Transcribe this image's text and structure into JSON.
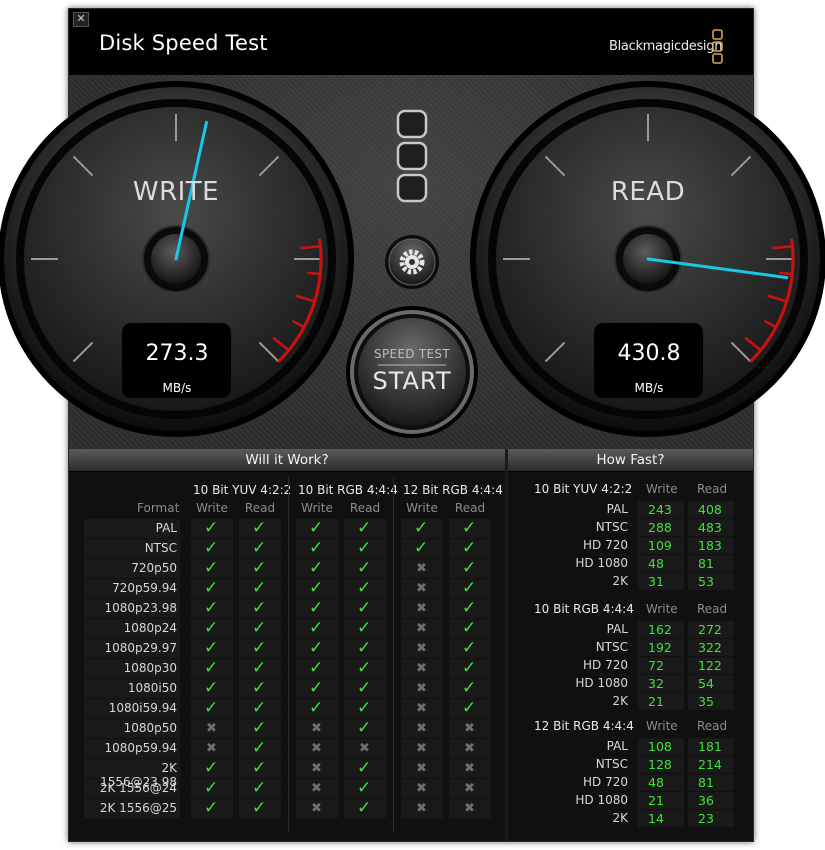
{
  "window": {
    "title": "Disk Speed Test",
    "brand": "Blackmagicdesign",
    "close_label": "✕"
  },
  "gauges": {
    "write": {
      "label": "WRITE",
      "value": "273.3",
      "unit": "MB/s"
    },
    "read": {
      "label": "READ",
      "value": "430.8",
      "unit": "MB/s"
    }
  },
  "start_button": {
    "line1": "SPEED TEST",
    "line2": "START"
  },
  "icons": {
    "settings": "gear-icon",
    "logo": "blackmagic-logo-icon"
  },
  "colors": {
    "accent_needle": "#19c8e8",
    "ok_check": "#3fe23a",
    "redline": "#d01010"
  },
  "will_it_work": {
    "title": "Will it Work?",
    "format_header": "Format",
    "groups": [
      "10 Bit YUV 4:2:2",
      "10 Bit RGB 4:4:4",
      "12 Bit RGB 4:4:4"
    ],
    "sub": [
      "Write",
      "Read"
    ],
    "rows": [
      {
        "format": "PAL",
        "s": [
          1,
          1,
          1,
          1,
          1,
          1
        ]
      },
      {
        "format": "NTSC",
        "s": [
          1,
          1,
          1,
          1,
          1,
          1
        ]
      },
      {
        "format": "720p50",
        "s": [
          1,
          1,
          1,
          1,
          0,
          1
        ]
      },
      {
        "format": "720p59.94",
        "s": [
          1,
          1,
          1,
          1,
          0,
          1
        ]
      },
      {
        "format": "1080p23.98",
        "s": [
          1,
          1,
          1,
          1,
          0,
          1
        ]
      },
      {
        "format": "1080p24",
        "s": [
          1,
          1,
          1,
          1,
          0,
          1
        ]
      },
      {
        "format": "1080p29.97",
        "s": [
          1,
          1,
          1,
          1,
          0,
          1
        ]
      },
      {
        "format": "1080p30",
        "s": [
          1,
          1,
          1,
          1,
          0,
          1
        ]
      },
      {
        "format": "1080i50",
        "s": [
          1,
          1,
          1,
          1,
          0,
          1
        ]
      },
      {
        "format": "1080i59.94",
        "s": [
          1,
          1,
          1,
          1,
          0,
          1
        ]
      },
      {
        "format": "1080p50",
        "s": [
          0,
          1,
          0,
          1,
          0,
          0
        ]
      },
      {
        "format": "1080p59.94",
        "s": [
          0,
          1,
          0,
          0,
          0,
          0
        ]
      },
      {
        "format": "2K 1556@23.98",
        "s": [
          1,
          1,
          0,
          1,
          0,
          0
        ]
      },
      {
        "format": "2K 1556@24",
        "s": [
          1,
          1,
          0,
          1,
          0,
          0
        ]
      },
      {
        "format": "2K 1556@25",
        "s": [
          1,
          1,
          0,
          1,
          0,
          0
        ]
      }
    ]
  },
  "how_fast": {
    "title": "How Fast?",
    "sub": [
      "Write",
      "Read"
    ],
    "sections": [
      {
        "name": "10 Bit YUV 4:2:2",
        "rows": [
          {
            "label": "PAL",
            "write": "243",
            "read": "408"
          },
          {
            "label": "NTSC",
            "write": "288",
            "read": "483"
          },
          {
            "label": "HD 720",
            "write": "109",
            "read": "183"
          },
          {
            "label": "HD 1080",
            "write": "48",
            "read": "81"
          },
          {
            "label": "2K",
            "write": "31",
            "read": "53"
          }
        ]
      },
      {
        "name": "10 Bit RGB 4:4:4",
        "rows": [
          {
            "label": "PAL",
            "write": "162",
            "read": "272"
          },
          {
            "label": "NTSC",
            "write": "192",
            "read": "322"
          },
          {
            "label": "HD 720",
            "write": "72",
            "read": "122"
          },
          {
            "label": "HD 1080",
            "write": "32",
            "read": "54"
          },
          {
            "label": "2K",
            "write": "21",
            "read": "35"
          }
        ]
      },
      {
        "name": "12 Bit RGB 4:4:4",
        "rows": [
          {
            "label": "PAL",
            "write": "108",
            "read": "181"
          },
          {
            "label": "NTSC",
            "write": "128",
            "read": "214"
          },
          {
            "label": "HD 720",
            "write": "48",
            "read": "81"
          },
          {
            "label": "HD 1080",
            "write": "21",
            "read": "36"
          },
          {
            "label": "2K",
            "write": "14",
            "read": "23"
          }
        ]
      }
    ]
  }
}
